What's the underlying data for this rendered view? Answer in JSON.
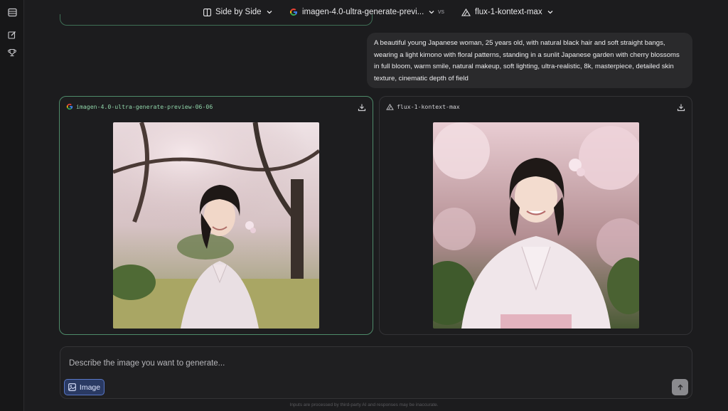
{
  "topbar": {
    "mode_label": "Side by Side",
    "model_a_label": "imagen-4.0-ultra-generate-previ...",
    "vs_label": "vs",
    "model_b_label": "flux-1-kontext-max"
  },
  "prompt": {
    "text": "A beautiful young Japanese woman, 25 years old, with natural black hair and soft straight bangs, wearing a light kimono with floral patterns, standing in a sunlit Japanese garden with cherry blossoms in full bloom, warm smile, natural makeup, soft lighting, ultra-realistic, 8k, masterpiece, detailed skin texture, cinematic depth of field"
  },
  "cards": [
    {
      "model_name": "imagen-4.0-ultra-generate-preview-06-06",
      "icon": "google-icon",
      "selected": true
    },
    {
      "model_name": "flux-1-kontext-max",
      "icon": "flux-logo-icon",
      "selected": false
    }
  ],
  "composer": {
    "placeholder": "Describe the image you want to generate...",
    "image_button_label": "Image"
  },
  "disclaimer": "Inputs are processed by third-party AI and responses may be inaccurate.",
  "colors": {
    "selected_border": "#4e8a69",
    "image_button_bg": "#2a3a63",
    "image_button_border": "#5876c6"
  }
}
